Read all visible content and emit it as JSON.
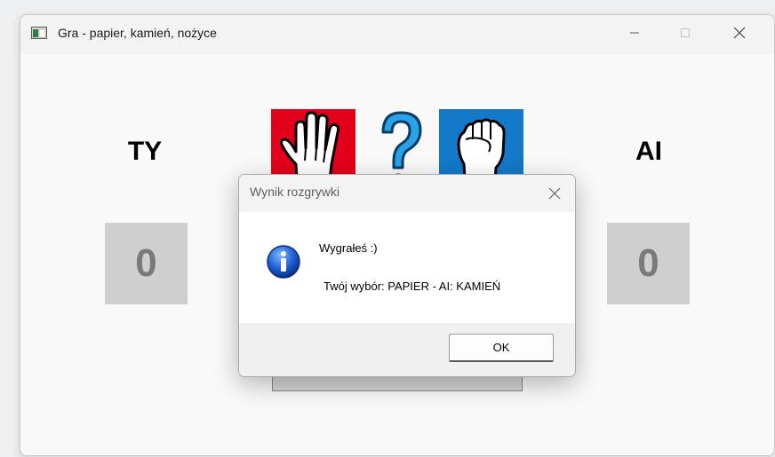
{
  "window": {
    "title": "Gra - papier, kamień, nożyce"
  },
  "game": {
    "player_label": "TY",
    "ai_label": "AI",
    "player_score": "0",
    "ai_score": "0",
    "player_choice_icon": "open-hand-paper-icon",
    "ai_choice_icon": "fist-rock-icon",
    "middle_icon": "question-mark-icon"
  },
  "dialog": {
    "title": "Wynik rozgrywki",
    "message": "Wygrałeś :)",
    "detail": "Twój wybór: PAPIER - AI: KAMIEŃ",
    "ok_label": "OK"
  },
  "colors": {
    "player_choice_bg": "#e3001b",
    "ai_choice_bg": "#1479c9",
    "question_mark": "#1d8bd6",
    "score_bg": "#cfcfcf"
  }
}
